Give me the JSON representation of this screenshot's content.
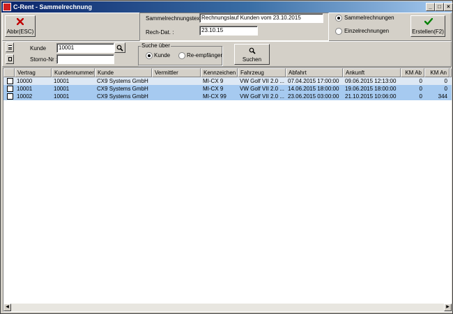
{
  "window": {
    "title": "C-Rent - Sammelrechnung"
  },
  "toolbar": {
    "cancel_label": "Abbr(ESC)",
    "create_label": "Erstellen(F2)"
  },
  "form": {
    "text_label": "Sammelrechnungstext :",
    "text_value": "Rechnungslauf Kunden vom 23.10.2015",
    "date_label": "Rech-Dat. :",
    "date_value": "23.10.15",
    "radio_collective": "Sammelrechnungen",
    "radio_single": "Einzelrechnungen"
  },
  "search": {
    "kunde_label": "Kunde",
    "kunde_value": "10001",
    "storno_label": "Storno-Nr :",
    "storno_value": "",
    "group_label": "Suche über",
    "radio_kunde": "Kunde",
    "radio_reempf": "Re-empfänger",
    "search_label": "Suchen"
  },
  "table": {
    "headers": [
      "Vertrag",
      "Kundennummer",
      "Kunde",
      "Vermittler",
      "Kennzeichen",
      "Fahrzeug",
      "Abfahrt",
      "Ankunft",
      "KM Ab",
      "KM An"
    ],
    "rows": [
      {
        "vertrag": "10000",
        "kundennummer": "10001",
        "kunde": "CX9 Systems GmbH",
        "vermittler": "",
        "kennzeichen": "MI-CX 9",
        "fahrzeug": "VW Golf VII 2.0 ...",
        "abfahrt": "07.04.2015 17:00:00",
        "ankunft": "09.06.2015 12:13:00",
        "km_ab": "0",
        "km_an": "0"
      },
      {
        "vertrag": "10001",
        "kundennummer": "10001",
        "kunde": "CX9 Systems GmbH",
        "vermittler": "",
        "kennzeichen": "MI-CX 9",
        "fahrzeug": "VW Golf VII 2.0 ...",
        "abfahrt": "14.06.2015 18:00:00",
        "ankunft": "19.06.2015 18:00:00",
        "km_ab": "0",
        "km_an": "0"
      },
      {
        "vertrag": "10002",
        "kundennummer": "10001",
        "kunde": "CX9 Systems GmbH",
        "vermittler": "",
        "kennzeichen": "MI-CX 99",
        "fahrzeug": "VW Golf VII 2.0 ...",
        "abfahrt": "23.06.2015 03:00:00",
        "ankunft": "21.10.2015 10:06:00",
        "km_ab": "0",
        "km_an": "344"
      }
    ]
  },
  "colors": {
    "row_alt": "#a6caf0",
    "row_first": "#dde8f4"
  }
}
